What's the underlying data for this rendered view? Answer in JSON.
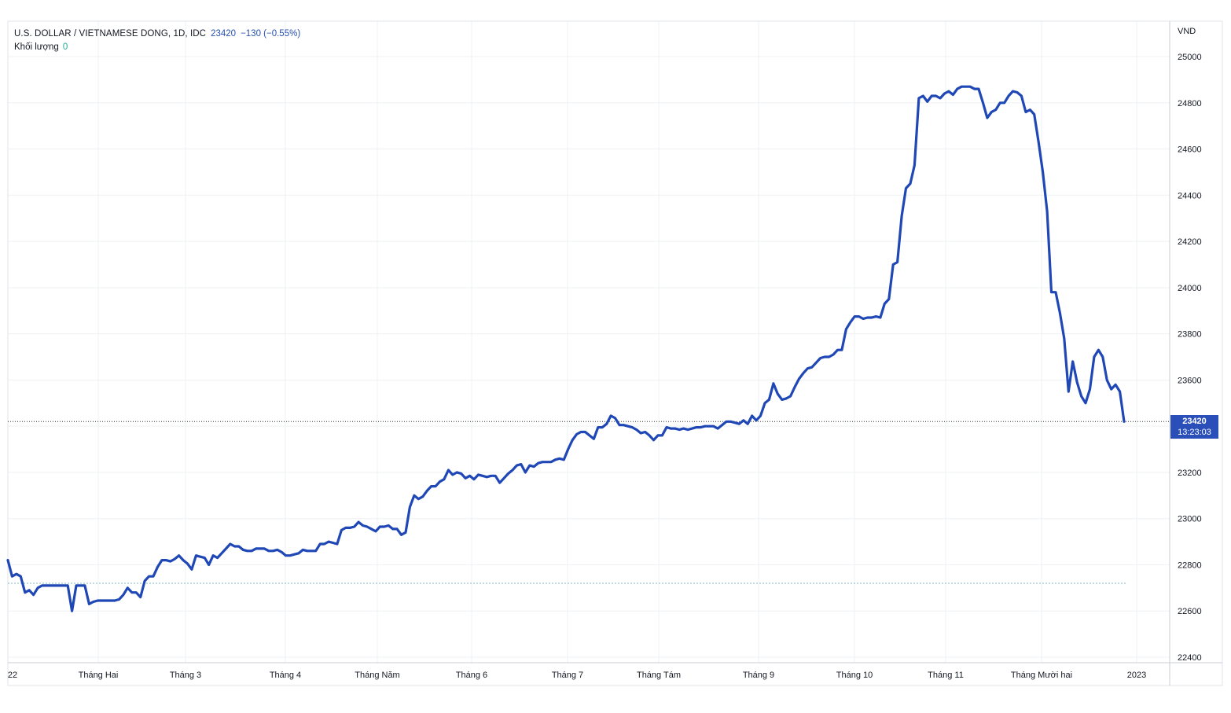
{
  "header": {
    "symbol": "U.S. DOLLAR / VIETNAMESE DONG, 1D, IDC",
    "last": "23420",
    "change": "−130 (−0.55%)",
    "volume_label": "Khối lượng",
    "volume_value": "0"
  },
  "price_axis": {
    "unit": "VND",
    "last_price": "23420",
    "countdown": "13:23:03"
  },
  "colors": {
    "line": "#1f47b5",
    "grid": "#eef0f3",
    "text": "#131722",
    "last_box": "#2a4fb8",
    "baseline": "#7fb7c9"
  },
  "chart_data": {
    "type": "line",
    "series": [
      {
        "values": [
          22820,
          22750,
          22760,
          22750,
          22680,
          22690,
          22670,
          22700,
          22710,
          22710,
          22710,
          22710,
          22710,
          22710,
          22710,
          22600,
          22710,
          22710,
          22710,
          22630,
          22640,
          22645,
          22645,
          22645,
          22645,
          22645,
          22650,
          22670,
          22700,
          22680,
          22680,
          22660,
          22730,
          22750,
          22750,
          22790,
          22820,
          22820,
          22815,
          22825,
          22840,
          22820,
          22805,
          22780,
          22840,
          22835,
          22830,
          22800,
          22840,
          22830,
          22850,
          22870,
          22890,
          22880,
          22880,
          22865,
          22860,
          22860,
          22870,
          22870,
          22870,
          22860,
          22860,
          22865,
          22855,
          22840,
          22840,
          22845,
          22850,
          22865,
          22860,
          22860,
          22860,
          22890,
          22890,
          22900,
          22895,
          22890,
          22950,
          22960,
          22960,
          22965,
          22985,
          22970,
          22965,
          22955,
          22945,
          22965,
          22965,
          22970,
          22955,
          22955,
          22930,
          22940,
          23050,
          23100,
          23085,
          23095,
          23120,
          23140,
          23140,
          23160,
          23170,
          23210,
          23190,
          23200,
          23195,
          23175,
          23185,
          23170,
          23190,
          23185,
          23180,
          23185,
          23185,
          23155,
          23175,
          23195,
          23210,
          23230,
          23235,
          23200,
          23230,
          23225,
          23240,
          23245,
          23245,
          23245,
          23255,
          23260,
          23255,
          23300,
          23340,
          23365,
          23375,
          23375,
          23360,
          23345,
          23395,
          23395,
          23410,
          23445,
          23435,
          23405,
          23405,
          23400,
          23395,
          23385,
          23370,
          23375,
          23360,
          23340,
          23360,
          23360,
          23395,
          23390,
          23390,
          23385,
          23390,
          23385,
          23390,
          23395,
          23395,
          23400,
          23400,
          23400,
          23390,
          23405,
          23420,
          23420,
          23415,
          23410,
          23425,
          23410,
          23445,
          23425,
          23445,
          23500,
          23515,
          23585,
          23540,
          23515,
          23520,
          23530,
          23570,
          23605,
          23630,
          23650,
          23655,
          23675,
          23695,
          23700,
          23700,
          23710,
          23730,
          23730,
          23820,
          23850,
          23875,
          23875,
          23865,
          23870,
          23870,
          23875,
          23870,
          23930,
          23950,
          24100,
          24110,
          24310,
          24430,
          24450,
          24530,
          24820,
          24830,
          24805,
          24830,
          24830,
          24820,
          24840,
          24850,
          24835,
          24860,
          24870,
          24870,
          24870,
          24860,
          24860,
          24800,
          24735,
          24760,
          24770,
          24800,
          24800,
          24830,
          24850,
          24845,
          24830,
          24760,
          24770,
          24750,
          24630,
          24500,
          24330,
          23980,
          23980,
          23890,
          23780,
          23550,
          23680,
          23590,
          23530,
          23500,
          23560,
          23700,
          23730,
          23700,
          23600,
          23560,
          23580,
          23550,
          23420
        ]
      }
    ],
    "x_tick_labels": [
      "22",
      "Tháng Hai",
      "Tháng 3",
      "Tháng 4",
      "Tháng Năm",
      "Tháng 6",
      "Tháng 7",
      "Tháng Tám",
      "Tháng 9",
      "Tháng 10",
      "Tháng 11",
      "Tháng Mười hai",
      "2023"
    ],
    "y_ticks": [
      22400,
      22600,
      22800,
      23000,
      23200,
      23400,
      23600,
      23800,
      24000,
      24200,
      24400,
      24600,
      24800,
      25000
    ],
    "ylim": [
      22400,
      25000
    ],
    "last_value": 23420,
    "baseline_value": 22720,
    "grid": true
  }
}
